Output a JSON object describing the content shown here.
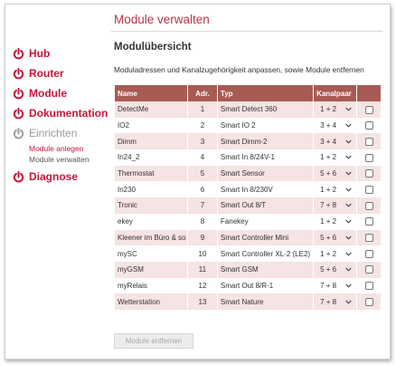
{
  "page": {
    "title": "Module verwalten"
  },
  "sidebar": {
    "items": [
      {
        "label": "Hub"
      },
      {
        "label": "Router"
      },
      {
        "label": "Module"
      },
      {
        "label": "Dokumentation"
      },
      {
        "label": "Einrichten",
        "sub": [
          {
            "label": "Module anlegen"
          },
          {
            "label": "Module verwalten"
          }
        ]
      },
      {
        "label": "Diagnose"
      }
    ]
  },
  "main": {
    "section_title": "Modulübersicht",
    "description": "Moduladressen und Kanalzugehörigkeit anpassen, sowie Module entfernen",
    "table": {
      "headers": {
        "name": "Name",
        "adr": "Adr.",
        "typ": "Typ",
        "kanalpaar": "Kanalpaar",
        "check": ""
      },
      "rows": [
        {
          "name": "DetectMe",
          "adr": "1",
          "typ": "Smart Detect 360",
          "kanalpaar": "1 + 2"
        },
        {
          "name": "IO2",
          "adr": "2",
          "typ": "Smart IO 2",
          "kanalpaar": "3 + 4"
        },
        {
          "name": "Dimm",
          "adr": "3",
          "typ": "Smart Dimm-2",
          "kanalpaar": "3 + 4"
        },
        {
          "name": "In24_2",
          "adr": "4",
          "typ": "Smart In 8/24V-1",
          "kanalpaar": "1 + 2"
        },
        {
          "name": "Thermostat",
          "adr": "5",
          "typ": "Smart Sensor",
          "kanalpaar": "5 + 6"
        },
        {
          "name": "In230",
          "adr": "6",
          "typ": "Smart In 8/230V",
          "kanalpaar": "1 + 2"
        },
        {
          "name": "Tronic",
          "adr": "7",
          "typ": "Smart Out 8/T",
          "kanalpaar": "7 + 8"
        },
        {
          "name": "ekey",
          "adr": "8",
          "typ": "Fanekey",
          "kanalpaar": "1 + 2"
        },
        {
          "name": "Kleener im Büro & so",
          "adr": "9",
          "typ": "Smart Controller Mini",
          "kanalpaar": "5 + 6"
        },
        {
          "name": "mySC",
          "adr": "10",
          "typ": "Smart Controller XL-2 (LE2)",
          "kanalpaar": "1 + 2"
        },
        {
          "name": "myGSM",
          "adr": "11",
          "typ": "Smart GSM",
          "kanalpaar": "5 + 6"
        },
        {
          "name": "myRelais",
          "adr": "12",
          "typ": "Smart Out 8/R-1",
          "kanalpaar": "7 + 8"
        },
        {
          "name": "Wetterstation",
          "adr": "13",
          "typ": "Smart Nature",
          "kanalpaar": "7 + 8"
        }
      ]
    },
    "remove_button": "Module entfernen"
  },
  "colors": {
    "accent": "#c4163b",
    "header_bg": "#a85a54",
    "row_alt": "#f6e3e3",
    "title": "#b3374a"
  },
  "icons": {
    "nav": "power-icon",
    "select": "chevron-down-icon"
  }
}
